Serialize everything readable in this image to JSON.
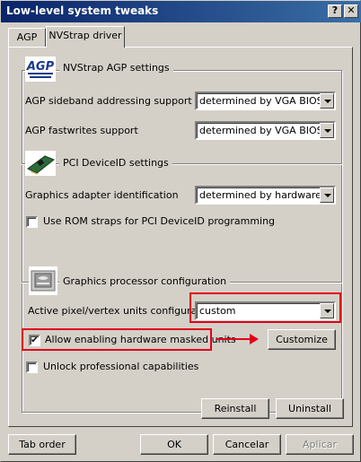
{
  "window": {
    "title": "Low-level system tweaks",
    "help_glyph": "?",
    "close_glyph": "✕"
  },
  "tabs": [
    {
      "label": "AGP"
    },
    {
      "label": "NVStrap driver"
    }
  ],
  "agp_group": {
    "title": "NVStrap AGP settings",
    "logo_text": "AGP",
    "sideband_label": "AGP sideband addressing support",
    "sideband_value": "determined by VGA BIOS",
    "fastwrites_label": "AGP fastwrites support",
    "fastwrites_value": "determined by VGA BIOS"
  },
  "pci_group": {
    "title": "PCI DeviceID settings",
    "adapter_label": "Graphics adapter identification",
    "adapter_value": "determined by hardware",
    "rom_straps_label": "Use ROM straps for PCI DeviceID programming",
    "rom_straps_checked": false
  },
  "gpu_group": {
    "title": "Graphics processor configuration",
    "units_label": "Active pixel/vertex units configuration",
    "units_value": "custom",
    "masked_units_label": "Allow enabling hardware masked units",
    "masked_units_checked": true,
    "check_glyph": "✔",
    "customize_label": "Customize",
    "unlock_label": "Unlock professional capabilities",
    "unlock_checked": false
  },
  "panel_buttons": {
    "reinstall": "Reinstall",
    "uninstall": "Uninstall"
  },
  "footer": {
    "tab_order": "Tab order",
    "ok": "OK",
    "cancel": "Cancelar",
    "apply": "Aplicar"
  },
  "icons": {
    "agp": "agp-logo-icon",
    "pci": "pci-card-icon",
    "gpu": "nvidia-chip-icon",
    "help": "help-icon",
    "close": "close-icon"
  },
  "colors": {
    "highlight": "#e0001a",
    "titlebar": "#0a246a"
  }
}
